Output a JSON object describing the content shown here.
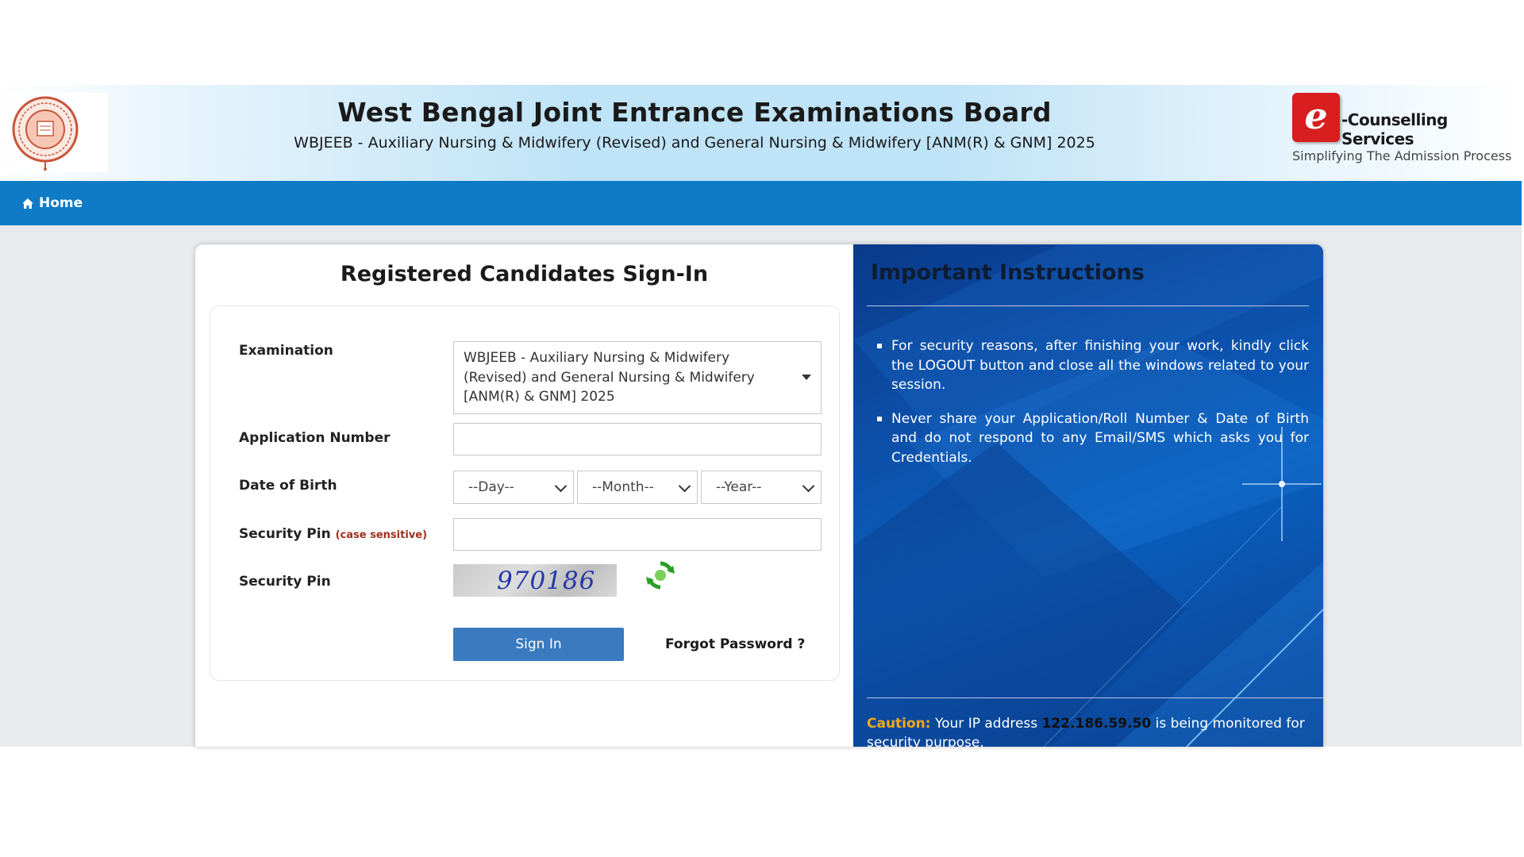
{
  "header": {
    "title": "West Bengal Joint Entrance Examinations Board",
    "subtitle": "WBJEEB - Auxiliary Nursing & Midwifery (Revised) and General Nursing & Midwifery [ANM(R) & GNM] 2025",
    "ec_logo_letters": "e",
    "ec_name": "-Counselling Services",
    "ec_tagline": "Simplifying The Admission Process"
  },
  "nav": {
    "home_label": "Home"
  },
  "form": {
    "title": "Registered Candidates Sign-In",
    "examination_label": "Examination",
    "examination_value": "WBJEEB - Auxiliary Nursing & Midwifery (Revised) and General Nursing & Midwifery [ANM(R) & GNM] 2025",
    "application_label": "Application Number",
    "application_value": "",
    "dob_label": "Date of Birth",
    "day_placeholder": "--Day--",
    "month_placeholder": "--Month--",
    "year_placeholder": "--Year--",
    "pin_label": "Security Pin",
    "pin_note": "(case sensitive)",
    "pin_value": "",
    "captcha_label": "Security Pin",
    "captcha_value": "970186",
    "signin_label": "Sign In",
    "forgot_label": "Forgot Password ?"
  },
  "instructions": {
    "title": "Important Instructions",
    "items": [
      "For security reasons, after finishing your work, kindly click the LOGOUT button and close all the windows related to your session.",
      "Never share your Application/Roll Number & Date of Birth and do not respond to any Email/SMS which asks you for Credentials."
    ],
    "caution_label": "Caution:",
    "caution_pre": " Your IP address ",
    "ip_address": "122.186.59.50",
    "caution_post": " is being monitored for security purpose."
  },
  "colors": {
    "nav_bg": "#0f7bc6",
    "signin_bg": "#3a7bc0",
    "ec_red": "#d81e1e",
    "caution_orange": "#f7a81b",
    "panel_blue": "#0c4fa8"
  },
  "icons": {
    "home": "home-icon",
    "refresh": "refresh-icon",
    "dropdown": "chevron-down-icon"
  }
}
